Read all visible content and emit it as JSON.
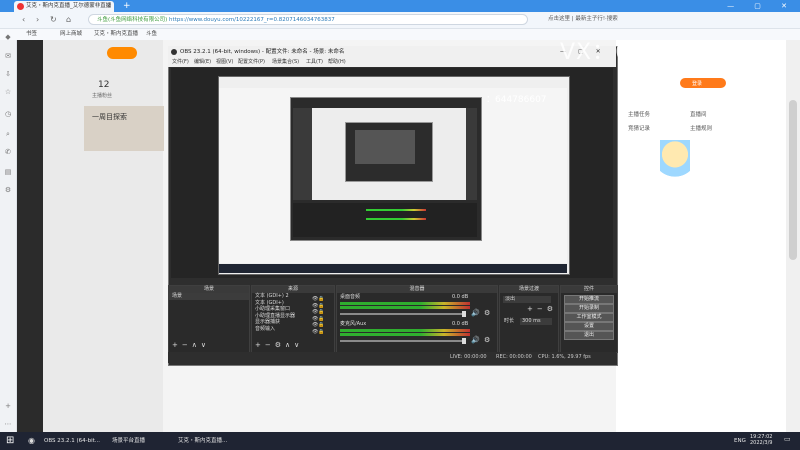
{
  "browser": {
    "tab_title": "艾克・斯内克直播_艾尔德蒙非直播",
    "new_tab": "+",
    "window_controls": "— ▢ ✕",
    "site_name": "斗鱼(斗鱼网络科技有限公司)",
    "url": "https://www.douyu.com/10222167_r=0.8207146034763837",
    "search_placeholder": "点击这里 | 最新主子行!·搜索",
    "bookmarks": [
      "书签",
      "网上商城",
      "艾克・斯内克直播",
      "斗鱼"
    ]
  },
  "page": {
    "count": "12",
    "count_label": "主播粉丝",
    "title": "一周目探索",
    "login": "登录",
    "right_items": [
      "主播任务",
      "直播间",
      "竞猜记录",
      "主播规则"
    ],
    "watermark": "VX：644786607"
  },
  "obs": {
    "title": "OBS 23.2.1 (64-bit, windows) - 配置文件: 未命名 - 场景: 未命名",
    "menu": [
      "文件(F)",
      "编辑(E)",
      "视图(V)",
      "配置文件(P)",
      "场景集合(S)",
      "工具(T)",
      "帮助(H)"
    ],
    "docks": {
      "scenes": {
        "title": "场景",
        "items": [
          "场景"
        ]
      },
      "sources": {
        "title": "来源",
        "items": [
          "文本 (GDI+) 2",
          "文本 (GDI+)",
          "小助理采集窗口",
          "小助理直播显示器",
          "显示器捕获",
          "音频输入"
        ]
      },
      "mixer": {
        "title": "混音器",
        "ch1": "桌面音频",
        "ch1_db": "0.0 dB",
        "ch2": "麦克风/Aux",
        "ch2_db": "0.0 dB"
      },
      "transitions": {
        "title": "场景过渡",
        "type": "淡出",
        "duration_label": "时长",
        "duration": "300 ms"
      },
      "controls": {
        "title": "控件",
        "buttons": [
          "开始推流",
          "开始录制",
          "工作室模式",
          "设置",
          "退出"
        ]
      }
    },
    "status": {
      "live": "LIVE: 00:00:00",
      "rec": "REC: 00:00:00",
      "cpu": "CPU: 1.6%, 29.97 fps"
    },
    "nested_watermark": "：644786607"
  },
  "taskbar": {
    "apps": [
      "OBS 23.2.1 (64-bit...",
      "场景平台直播",
      "艾克・斯内克直播..."
    ],
    "time": "19:27:02",
    "date": "2022/3/9",
    "lang": "ENG"
  },
  "colors": {
    "accent": "#3a8ee6",
    "brand": "#ff7a1a",
    "meter_green": "#2fae2f"
  }
}
